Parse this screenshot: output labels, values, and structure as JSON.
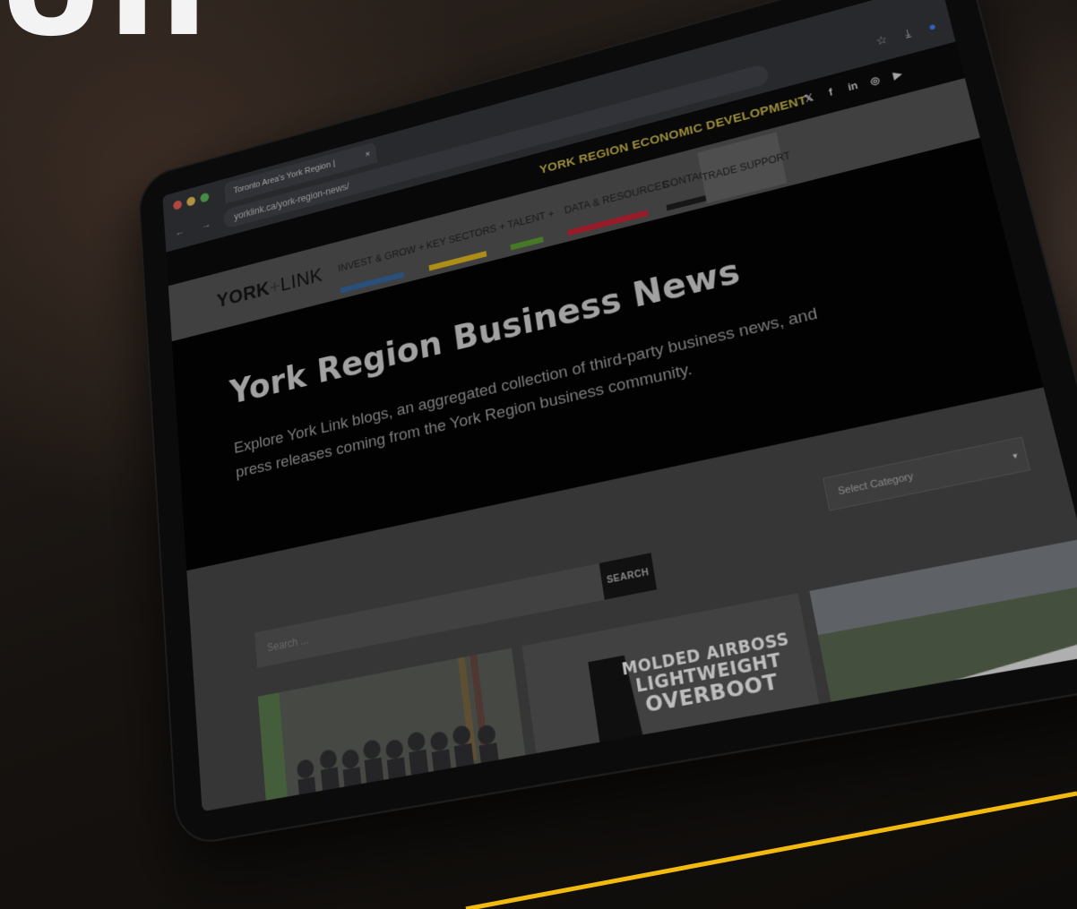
{
  "overlay": {
    "big_text": "UII"
  },
  "browser": {
    "tab_title": "Toronto Area's York Region |",
    "tab_close": "×",
    "url": "yorklink.ca/york-region-news/",
    "nav_arrows": "← → C",
    "icons": {
      "star": "☆",
      "download": "⤓",
      "profile": "●"
    }
  },
  "topbar": {
    "label": "YORK REGION ECONOMIC DEVELOPMENT",
    "socials": [
      "twitter-icon",
      "facebook-icon",
      "linkedin-icon",
      "instagram-icon",
      "youtube-icon"
    ],
    "social_glyphs": [
      "𝕏",
      "f",
      "in",
      "◎",
      "▶"
    ]
  },
  "nav": {
    "logo": {
      "york": "YORK",
      "plus": "+",
      "link": "LINK"
    },
    "items": [
      {
        "label": "INVEST & GROW +",
        "color": "#2f5b8c"
      },
      {
        "label": "KEY SECTORS +",
        "color": "#c6a21a"
      },
      {
        "label": "TALENT +",
        "color": "#4f8a2c"
      },
      {
        "label": "DATA & RESOURCES",
        "color": "#b01e2e"
      },
      {
        "label": "CONTACT",
        "color": "#1a1a1a"
      }
    ],
    "trade": "TRADE SUPPORT"
  },
  "hero": {
    "title": "York Region Business News",
    "subtitle": "Explore York Link blogs, an aggregated collection of third-party business news, and press releases coming from the York Region business community."
  },
  "content": {
    "search_placeholder": "Search ...",
    "search_button": "SEARCH",
    "category_label": "Select Category",
    "category_caret": "▾"
  },
  "cards": [
    {
      "image": "group-photo-signing"
    },
    {
      "image": "molded-airboss-overboot",
      "text_lines": [
        "MOLDED AIRBOSS",
        "LIGHTWEIGHT",
        "OVERBOOT"
      ]
    },
    {
      "image": "aerial-industrial-building"
    }
  ],
  "accent": "#f2b90f"
}
